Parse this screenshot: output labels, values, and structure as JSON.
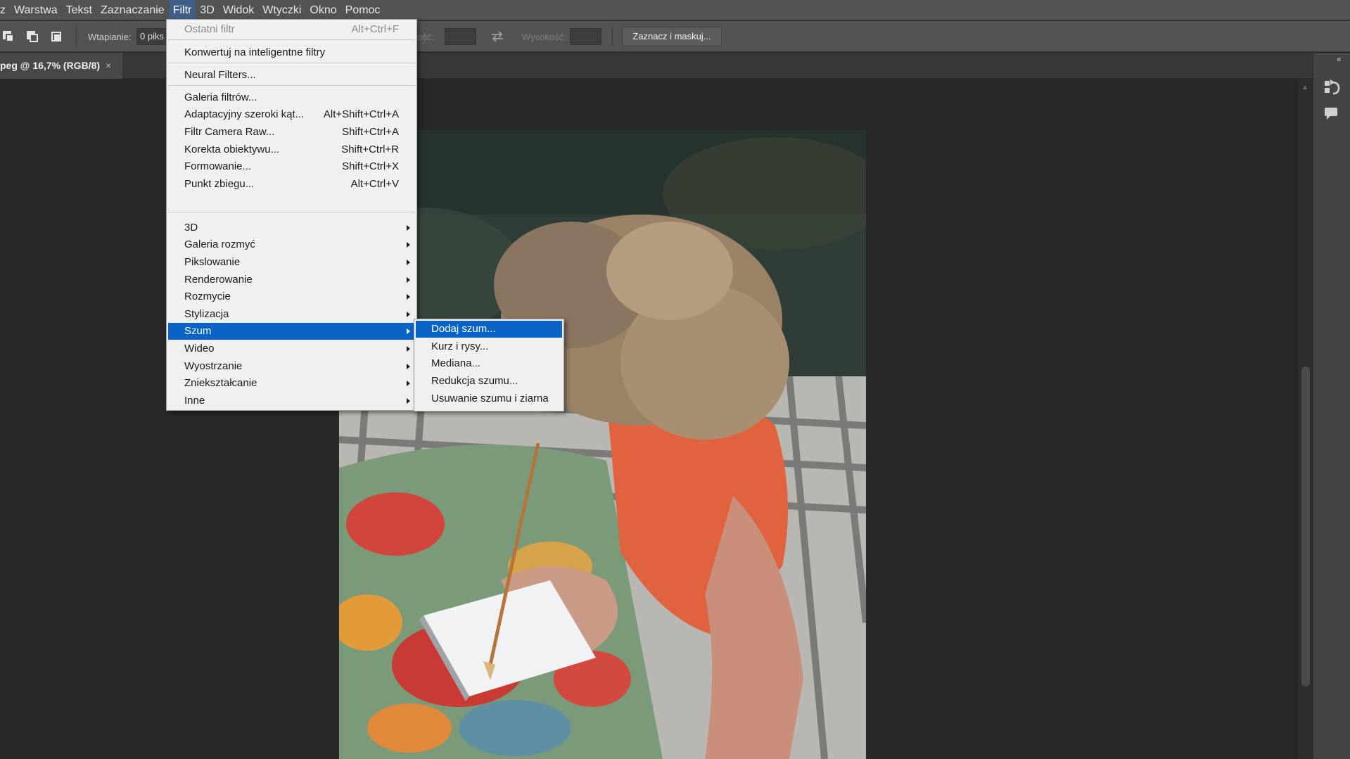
{
  "menubar": {
    "items": [
      {
        "label": "z"
      },
      {
        "label": "Warstwa"
      },
      {
        "label": "Tekst"
      },
      {
        "label": "Zaznaczanie"
      },
      {
        "label": "Filtr"
      },
      {
        "label": "3D"
      },
      {
        "label": "Widok"
      },
      {
        "label": "Wtyczki"
      },
      {
        "label": "Okno"
      },
      {
        "label": "Pomoc"
      }
    ],
    "active": "Filtr"
  },
  "options": {
    "feather_label": "Wtapianie:",
    "feather_value": "0 piks",
    "width_label": "ość:",
    "width_value": "",
    "height_label": "Wysokość:",
    "height_value": "",
    "select_mask_label": "Zaznacz i maskuj..."
  },
  "document": {
    "tab_title": "peg @ 16,7% (RGB/8)",
    "close_glyph": "×"
  },
  "filter_menu": {
    "items": [
      {
        "label": "Ostatni filtr",
        "shortcut": "Alt+Ctrl+F",
        "disabled": true
      },
      {
        "label": "Konwertuj na inteligentne filtry",
        "shortcut": ""
      },
      {
        "label": "Neural Filters...",
        "shortcut": ""
      },
      {
        "label": "Galeria filtrów...",
        "shortcut": ""
      },
      {
        "label": "Adaptacyjny szeroki kąt...",
        "shortcut": "Alt+Shift+Ctrl+A"
      },
      {
        "label": "Filtr Camera Raw...",
        "shortcut": "Shift+Ctrl+A"
      },
      {
        "label": "Korekta obiektywu...",
        "shortcut": "Shift+Ctrl+R"
      },
      {
        "label": "Formowanie...",
        "shortcut": "Shift+Ctrl+X"
      },
      {
        "label": "Punkt zbiegu...",
        "shortcut": "Alt+Ctrl+V"
      },
      {
        "label": "3D",
        "submenu": true
      },
      {
        "label": "Galeria rozmyć",
        "submenu": true
      },
      {
        "label": "Pikslowanie",
        "submenu": true
      },
      {
        "label": "Renderowanie",
        "submenu": true
      },
      {
        "label": "Rozmycie",
        "submenu": true
      },
      {
        "label": "Stylizacja",
        "submenu": true
      },
      {
        "label": "Szum",
        "submenu": true,
        "highlighted": true
      },
      {
        "label": "Wideo",
        "submenu": true
      },
      {
        "label": "Wyostrzanie",
        "submenu": true
      },
      {
        "label": "Zniekształcanie",
        "submenu": true
      },
      {
        "label": "Inne",
        "submenu": true
      }
    ]
  },
  "noise_submenu": {
    "items": [
      {
        "label": "Dodaj szum...",
        "highlighted": true
      },
      {
        "label": "Kurz i rysy..."
      },
      {
        "label": "Mediana..."
      },
      {
        "label": "Redukcja szumu..."
      },
      {
        "label": "Usuwanie szumu i ziarna"
      }
    ]
  },
  "colors": {
    "menubar_bg": "#535353",
    "menu_highlight": "#0a64c8",
    "canvas_bg": "#282828"
  },
  "icons": [
    "new-selection-icon",
    "add-to-selection-icon",
    "intersect-selection-icon",
    "swap-icon",
    "history-panel-icon",
    "comments-panel-icon",
    "collapse-panels-icon"
  ]
}
